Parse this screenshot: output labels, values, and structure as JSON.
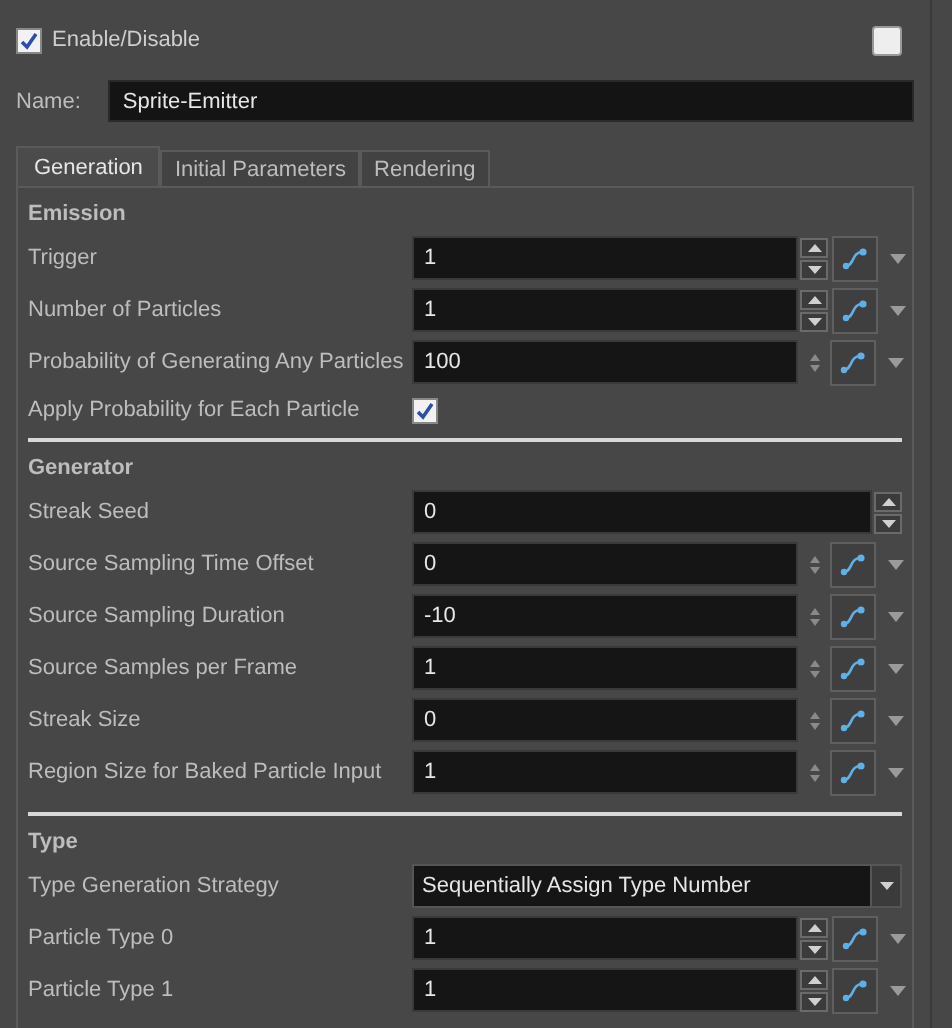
{
  "enable": {
    "label": "Enable/Disable",
    "checked": true
  },
  "color_swatch": {
    "checked": false
  },
  "name": {
    "label": "Name:",
    "value": "Sprite-Emitter"
  },
  "tabs": [
    {
      "label": "Generation",
      "selected": true
    },
    {
      "label": "Initial Parameters",
      "selected": false
    },
    {
      "label": "Rendering",
      "selected": false
    }
  ],
  "sections": [
    {
      "title": "Emission",
      "rows": [
        {
          "kind": "spin",
          "label": "Trigger",
          "value": "1"
        },
        {
          "kind": "small-spin",
          "label": "Number of Particles",
          "value": "1"
        },
        {
          "kind": "small-spin-flat",
          "label": "Probability of Generating Any Particles",
          "value": "100"
        },
        {
          "kind": "checkbox",
          "label": "Apply Probability for Each Particle",
          "checked": true
        }
      ]
    },
    {
      "title": "Generator",
      "rows": [
        {
          "kind": "seed",
          "label": "Streak Seed",
          "value": "0"
        },
        {
          "kind": "small-spin-flat",
          "label": "Source Sampling Time Offset",
          "value": "0"
        },
        {
          "kind": "small-spin-flat",
          "label": "Source Sampling Duration",
          "value": "-10"
        },
        {
          "kind": "small-spin-flat",
          "label": "Source Samples per Frame",
          "value": "1"
        },
        {
          "kind": "small-spin-flat",
          "label": "Streak Size",
          "value": "0"
        },
        {
          "kind": "small-spin-flat",
          "label": "Region Size for Baked Particle Input",
          "value": "1"
        }
      ]
    },
    {
      "title": "Type",
      "rows": [
        {
          "kind": "dropdown",
          "label": "Type Generation Strategy",
          "value": "Sequentially Assign Type Number"
        },
        {
          "kind": "spin",
          "label": "Particle Type 0",
          "value": "1"
        },
        {
          "kind": "spin",
          "label": "Particle Type 1",
          "value": "1"
        }
      ]
    }
  ]
}
